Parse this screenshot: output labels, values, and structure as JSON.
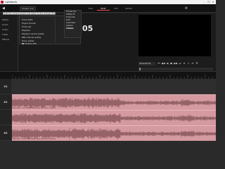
{
  "window": {
    "title": "Lightworks",
    "minimize": "–",
    "maximize": "☐",
    "close": "✕"
  },
  "toolbar": {
    "project_icon": "project-icon",
    "project_name": "Project 111",
    "tabs": [
      {
        "label": "LOG"
      },
      {
        "label": "EDIT"
      },
      {
        "label": "VFX"
      },
      {
        "label": "AUDIO"
      }
    ],
    "settings_icon": "gear-icon"
  },
  "tooltip": "Edit the current project and return to the original Timeline",
  "left_panel": {
    "items": [
      "Media",
      "Audio",
      "Video",
      "Titles",
      "Effects"
    ]
  },
  "settings": {
    "rows": [
      {
        "label": "Frame Rate",
        "value": "25"
      },
      {
        "label": "Project Format",
        "value": "1080p"
      },
      {
        "label": "Timecode",
        "value": "Timecode"
      },
      {
        "label": "Playback",
        "value": "Full"
      },
      {
        "label": "Playback render quality",
        "value": "Full"
      },
      {
        "label": "RBG channel quality",
        "value": "Full"
      },
      {
        "label": "Proxy quality",
        "value": "Full"
      },
      {
        "label": "Timeline FPS",
        "value": ""
      }
    ]
  },
  "menu_col": {
    "items": [
      "Frames (0)",
      "1080p 25",
      "Timecode",
      "8 bit",
      "Automatic",
      "System Defaults",
      "Disable"
    ]
  },
  "timecode_display": "05",
  "viewer": {
    "timecode": "00:00:00:05",
    "controls": [
      "⏮",
      "◀◀",
      "◀",
      "▶",
      "▶▶",
      "⏭",
      "⏺",
      "✂",
      "⇄",
      "☰"
    ]
  },
  "tracks": [
    {
      "label": "V1",
      "clip": ""
    },
    {
      "label": "A1",
      "clip": "Clip 0:00 ~ 0:13 Effect Test Tone Test Tone 1 Stereo"
    },
    {
      "label": "A2",
      "clip": "Clip 0:00 ~ 0:13 Effect Test Tone Test Tone 2 Stereo"
    }
  ],
  "colors": {
    "accent": "#ff4b56",
    "clip": "#d49a9f",
    "waveform": "#6b3e43"
  }
}
